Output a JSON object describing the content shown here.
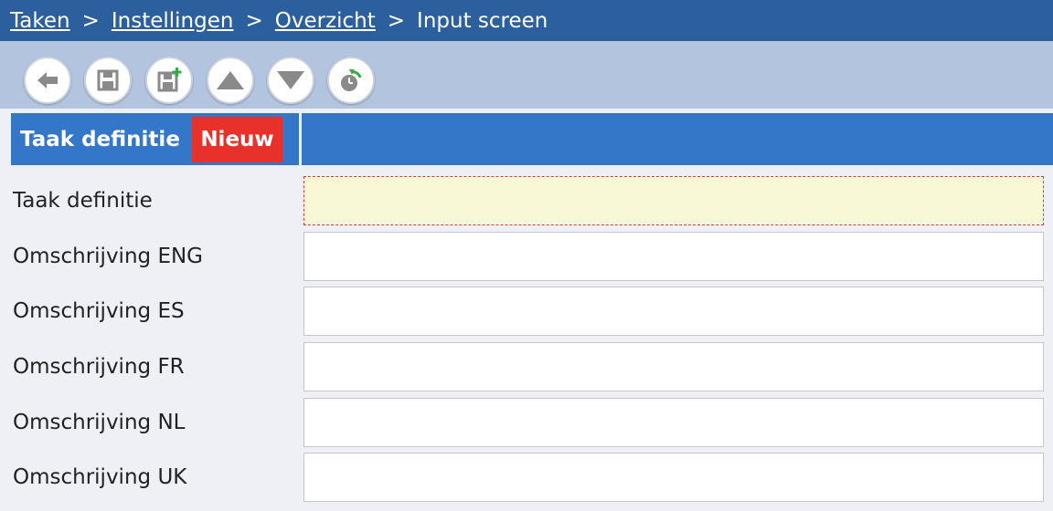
{
  "breadcrumb": {
    "items": [
      "Taken",
      "Instellingen",
      "Overzicht"
    ],
    "current": "Input screen",
    "separator": ">"
  },
  "toolbar": {
    "buttons": [
      {
        "name": "back",
        "icon": "arrow-left-icon"
      },
      {
        "name": "save",
        "icon": "floppy-disk-icon"
      },
      {
        "name": "save-new",
        "icon": "floppy-disk-plus-icon"
      },
      {
        "name": "move-up",
        "icon": "triangle-up-icon"
      },
      {
        "name": "move-down",
        "icon": "triangle-down-icon"
      },
      {
        "name": "history",
        "icon": "clock-refresh-icon"
      }
    ]
  },
  "header": {
    "title": "Taak definitie",
    "badge": "Nieuw"
  },
  "form": {
    "fields": [
      {
        "label": "Taak definitie",
        "value": "",
        "required": true
      },
      {
        "label": "Omschrijving ENG",
        "value": "",
        "required": false
      },
      {
        "label": "Omschrijving ES",
        "value": "",
        "required": false
      },
      {
        "label": "Omschrijving FR",
        "value": "",
        "required": false
      },
      {
        "label": "Omschrijving NL",
        "value": "",
        "required": false
      },
      {
        "label": "Omschrijving UK",
        "value": "",
        "required": false
      }
    ]
  },
  "colors": {
    "breadcrumb_bg": "#2c5f9e",
    "toolbar_bg": "#b3c4de",
    "header_bg": "#3476c8",
    "badge_bg": "#e8312a",
    "required_bg": "#f8f8d7"
  }
}
